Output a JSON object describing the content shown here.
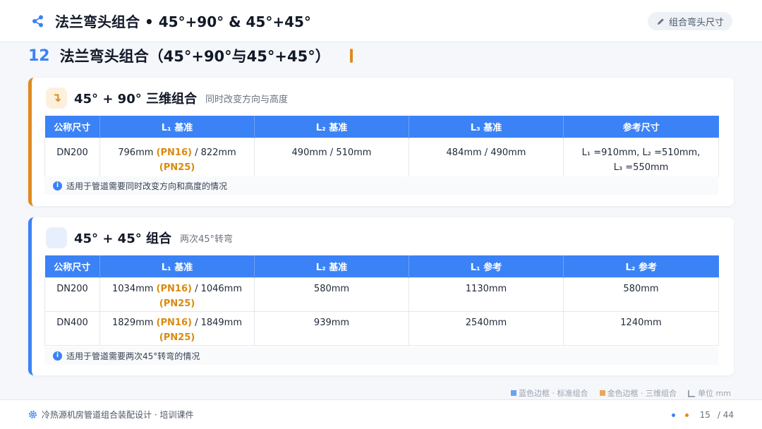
{
  "header": {
    "title": "法兰弯头组合 • 45°+90° & 45°+45°",
    "badge": "组合弯头尺寸"
  },
  "section": {
    "number": "12",
    "title": "法兰弯头组合（45°+90°与45°+45°）"
  },
  "card1": {
    "icon": "↴",
    "title": "45° + 90° 三维组合",
    "subtitle": "同时改变方向与高度",
    "headers": [
      "公称尺寸",
      "L₁ 基准",
      "L₂ 基准",
      "L₃ 基准",
      "参考尺寸"
    ],
    "row": {
      "size": "DN200",
      "l1_a": "796mm ",
      "l1_pn16": "(PN16)",
      "l1_b": " / 822mm",
      "l1_pn25": "(PN25)",
      "l2": "490mm / 510mm",
      "l3": "484mm / 490mm",
      "ref_line1": "L₁ =910mm, L₂ =510mm,",
      "ref_line2": "L₃ =550mm"
    },
    "note": "适用于管道需要同时改变方向和高度的情况"
  },
  "card2": {
    "title": "45° + 45° 组合",
    "subtitle": "两次45°转弯",
    "headers": [
      "公称尺寸",
      "L₁ 基准",
      "L₂ 基准",
      "L₁ 参考",
      "L₂ 参考"
    ],
    "rows": [
      {
        "size": "DN200",
        "l1_a": "1034mm ",
        "l1_pn16": "(PN16)",
        "l1_b": " / 1046mm",
        "l1_pn25": "(PN25)",
        "l2": "580mm",
        "l1_ref": "1130mm",
        "l2_ref": "580mm"
      },
      {
        "size": "DN400",
        "l1_a": "1829mm ",
        "l1_pn16": "(PN16)",
        "l1_b": " / 1849mm",
        "l1_pn25": "(PN25)",
        "l2": "939mm",
        "l1_ref": "2540mm",
        "l2_ref": "1240mm"
      }
    ],
    "note": "适用于管道需要两次45°转弯的情况"
  },
  "legend": {
    "blue_label": "蓝色边框 · 标准组合",
    "orange_label": "金色边框 · 三维组合",
    "unit_label": "单位 mm"
  },
  "footer": {
    "text": "冷热源机房管道组合装配设计 · 培训课件",
    "page": "15",
    "total": "/ 44"
  },
  "colors": {
    "accent_blue": "#3b82f6",
    "accent_orange": "#e08a1e"
  }
}
